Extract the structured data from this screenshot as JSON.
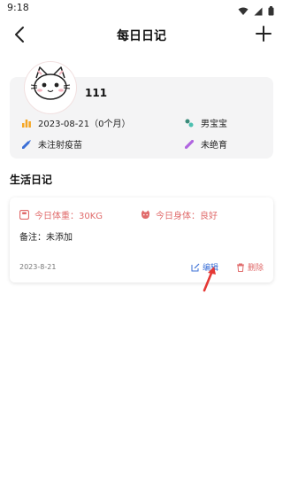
{
  "status_bar": {
    "time": "9:18"
  },
  "header": {
    "title": "每日日记"
  },
  "profile": {
    "name": "111",
    "birth": "2023-08-21（0个月）",
    "gender": "男宝宝",
    "vaccine": "未注射疫苗",
    "sterilization": "未绝育"
  },
  "diary": {
    "section_title": "生活日记",
    "entry": {
      "weight": "今日体重：30KG",
      "health": "今日身体：良好",
      "note": "备注：未添加",
      "date": "2023-8-21",
      "edit_label": "编辑",
      "delete_label": "删除"
    }
  },
  "colors": {
    "accent_red": "#e06b6b",
    "accent_blue": "#3b6fd6"
  }
}
